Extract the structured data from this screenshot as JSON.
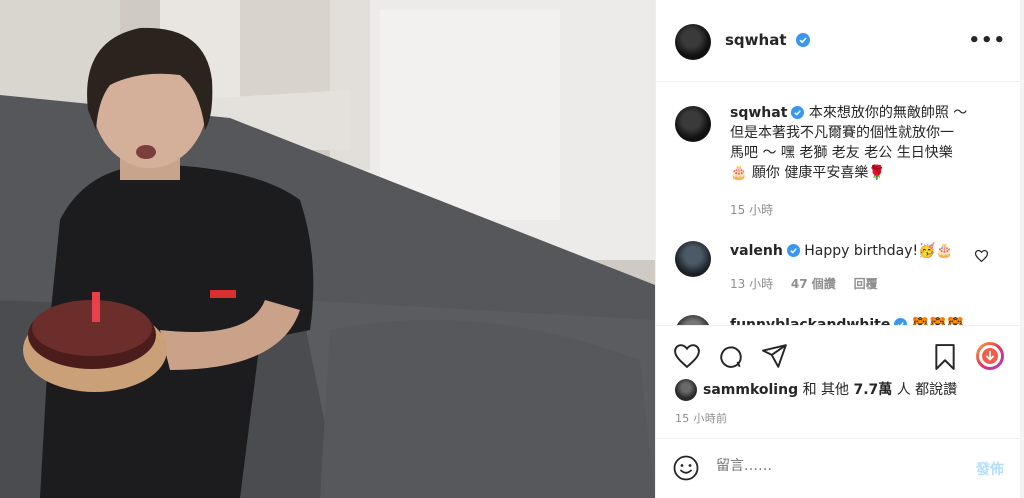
{
  "post": {
    "author": "sqwhat",
    "media_alt": "photo",
    "more_icon": "ellipsis-icon"
  },
  "caption": {
    "username": "sqwhat",
    "text_line1": "本來想放你的無敵帥照 ～",
    "text_line2": "但是本著我不凡爾賽的個性就放你一",
    "text_line3": "馬吧 ～ 嘿 老獅 老友 老公 生日快樂",
    "text_line4": "願你 健康平安喜樂",
    "time": "15 小時"
  },
  "comments": [
    {
      "username": "valenh",
      "text": "Happy birthday!",
      "time": "13 小時",
      "likes": "47 個讚",
      "reply": "回覆"
    },
    {
      "username": "funnyblackandwhite",
      "text": ""
    }
  ],
  "likes": {
    "username": "sammkoling",
    "connector": "和 其他",
    "count": "7.7萬",
    "suffix": "人 都說讚"
  },
  "timestamp": "15 小時前",
  "composer": {
    "placeholder": "留言……",
    "post_label": "發佈"
  },
  "colors": {
    "verified": "#3897f0",
    "post_disabled": "#b2dffc",
    "muted_text": "#8e8e8e",
    "divider": "#efefef"
  }
}
